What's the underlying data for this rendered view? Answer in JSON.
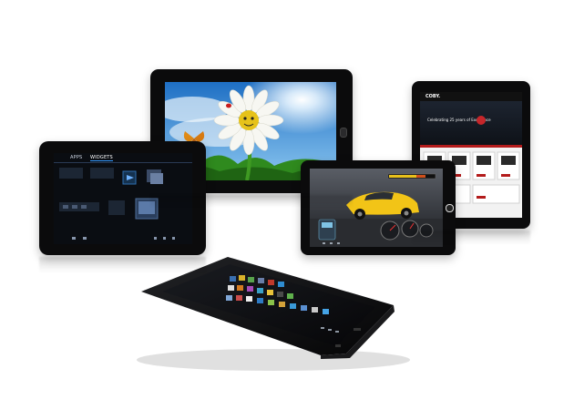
{
  "scene": {
    "background": "#ffffff",
    "devices": [
      {
        "id": "tablet-flower",
        "screen": "flower-wallpaper"
      },
      {
        "id": "tablet-apps",
        "screen": "android-apps-widgets"
      },
      {
        "id": "tablet-racing",
        "screen": "racing-game"
      },
      {
        "id": "tablet-website",
        "screen": "website"
      },
      {
        "id": "tablet-front",
        "screen": "android-homescreen"
      }
    ]
  },
  "apps_screen": {
    "tab_apps": "APPS",
    "tab_widgets": "WIDGETS"
  },
  "website_screen": {
    "logo": "COBY.",
    "headline": "Celebrating 25 years of Excellence"
  },
  "colors": {
    "bezel": "#0b0b0c",
    "sky_blue": "#3c8ed6",
    "grass_green": "#2f8a1e",
    "car_yellow": "#f2c417",
    "website_red": "#b31b1b"
  }
}
